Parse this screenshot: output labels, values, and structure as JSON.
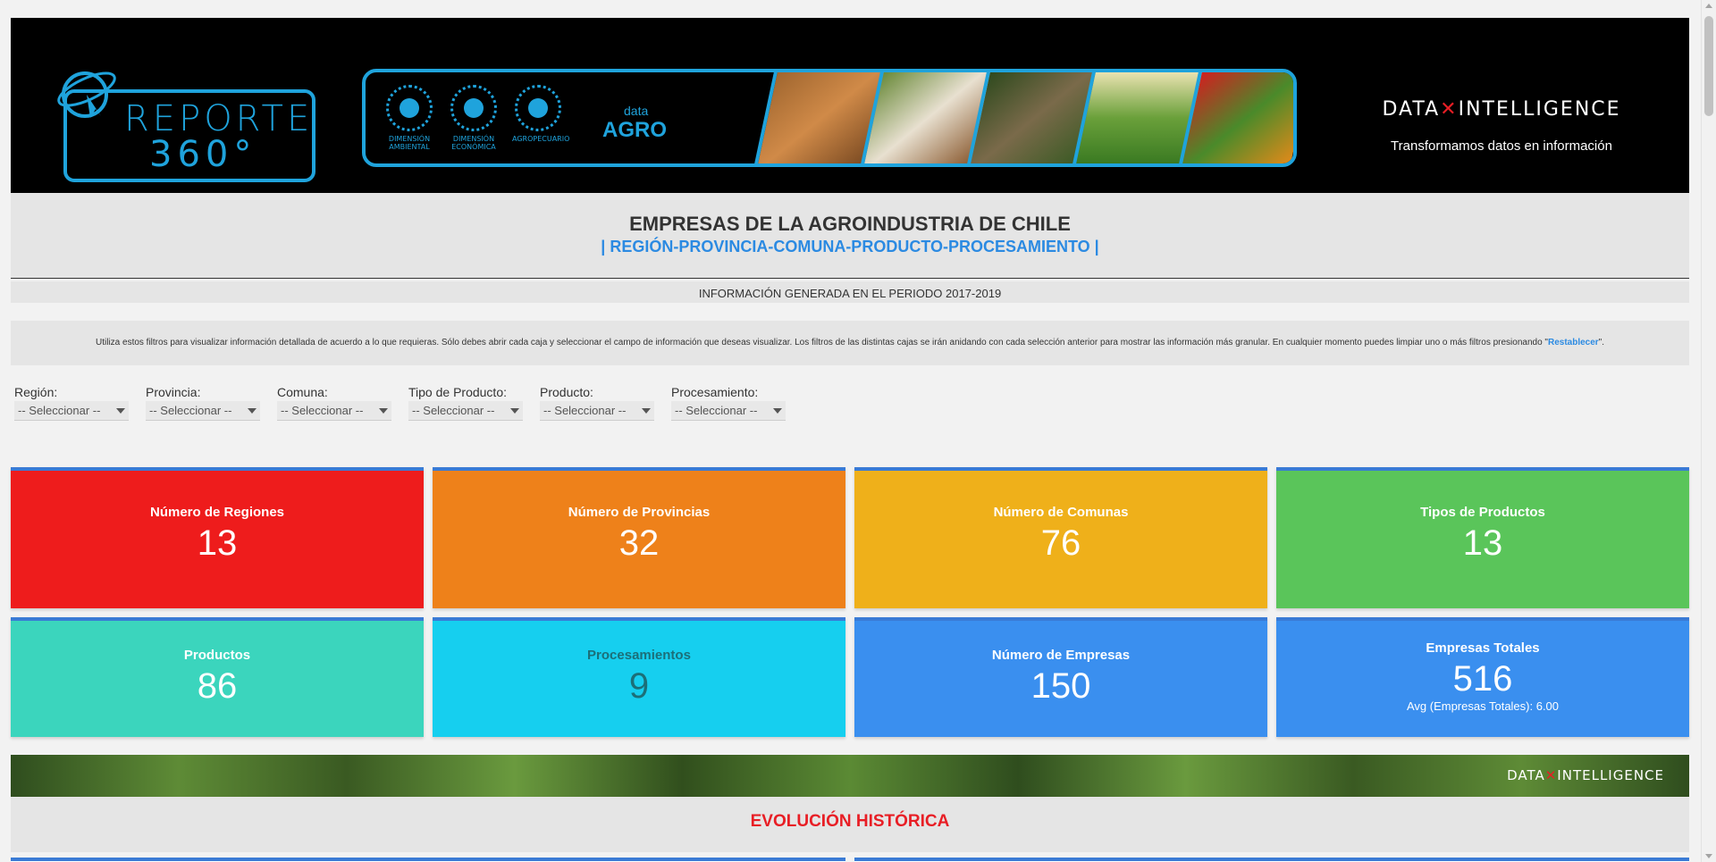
{
  "header": {
    "logo_line1": "REPORTE",
    "logo_line2": "360°",
    "dimensions": [
      "DIMENSIÓN AMBIENTAL",
      "DIMENSIÓN ECONÓMICA",
      "AGROPECUARIO"
    ],
    "data_agro_small": "data",
    "data_agro_big": "AGRO",
    "brand_left": "DATA",
    "brand_right": "INTELLIGENCE",
    "tagline": "Transformamos datos en información"
  },
  "title": {
    "main": "EMPRESAS DE LA AGROINDUSTRIA DE CHILE",
    "sub": "| REGIÓN-PROVINCIA-COMUNA-PRODUCTO-PROCESAMIENTO |",
    "period": "INFORMACIÓN GENERADA EN EL PERIODO 2017-2019"
  },
  "info": {
    "text": "Utiliza estos filtros para visualizar información detallada de acuerdo a lo que requieras. Sólo debes abrir cada caja y seleccionar el campo de información que deseas visualizar. Los filtros de las distintas cajas se irán anidando con cada selección anterior para mostrar las información más granular. En cualquier momento puedes limpiar uno o más filtros presionando \"",
    "link": "Restablecer",
    "suffix": "\"."
  },
  "filters": [
    {
      "label": "Región:",
      "value": "-- Seleccionar --"
    },
    {
      "label": "Provincia:",
      "value": "-- Seleccionar --"
    },
    {
      "label": "Comuna:",
      "value": "-- Seleccionar --"
    },
    {
      "label": "Tipo de Producto:",
      "value": "-- Seleccionar --"
    },
    {
      "label": "Producto:",
      "value": "-- Seleccionar --"
    },
    {
      "label": "Procesamiento:",
      "value": "-- Seleccionar --"
    }
  ],
  "cards": [
    {
      "label": "Número de Regiones",
      "value": "13",
      "color": "#ee1c1c"
    },
    {
      "label": "Número de Provincias",
      "value": "32",
      "color": "#ee811a"
    },
    {
      "label": "Número de Comunas",
      "value": "76",
      "color": "#efb01a"
    },
    {
      "label": "Tipos de Productos",
      "value": "13",
      "color": "#5ac55a"
    },
    {
      "label": "Productos",
      "value": "86",
      "color": "#3bd5bd"
    },
    {
      "label": "Procesamientos",
      "value": "9",
      "color": "#16cfef"
    },
    {
      "label": "Número de Empresas",
      "value": "150",
      "color": "#3a8fef"
    },
    {
      "label": "Empresas Totales",
      "value": "516",
      "avg": "Avg (Empresas Totales): 6.00",
      "color": "#3a8fef"
    }
  ],
  "band": {
    "brand_left": "DATA",
    "brand_right": "INTELLIGENCE"
  },
  "section": {
    "title": "EVOLUCIÓN HISTÓRICA"
  }
}
